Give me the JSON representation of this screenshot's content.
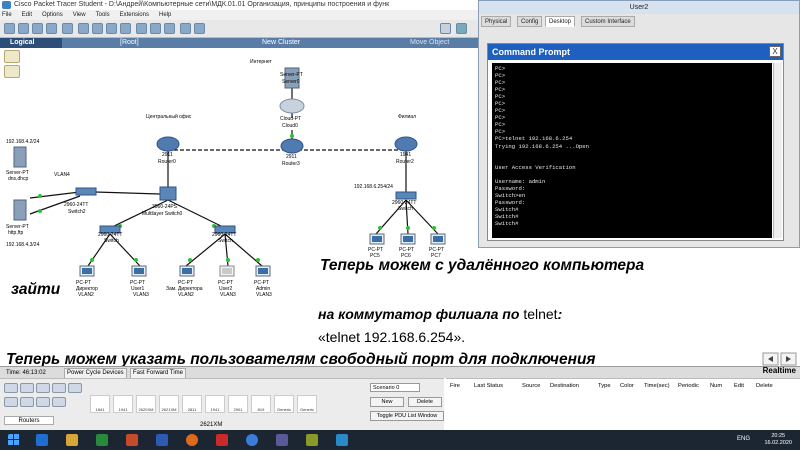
{
  "window": {
    "title": "Cisco Packet Tracer Student - D:\\Андрей\\Компьютерные сети\\МДК.01.01 Организация, принципы построения и функ",
    "menu": [
      "File",
      "Edit",
      "Options",
      "View",
      "Tools",
      "Extensions",
      "Help"
    ]
  },
  "workspace": {
    "mode": "Logical",
    "root": "[Root]",
    "cluster": "New Cluster",
    "move": "Move Object"
  },
  "topology": {
    "labels": {
      "internet": "Интернет",
      "central_office": "Центральный офис",
      "branch": "Филиал",
      "ip_dns": "192.168.4.2/24",
      "ip_http": "192.168.4.3/24",
      "ip_branch_switch": "192.168.6.254/24",
      "vlan4": "VLAN4"
    },
    "devices": {
      "server0": [
        "Server-PT",
        "Server0"
      ],
      "cloud0": [
        "Cloud-PT",
        "Cloud0"
      ],
      "router0": [
        "2911",
        "Router0"
      ],
      "router3": [
        "2911",
        "Router3"
      ],
      "router2": [
        "1941",
        "Router2"
      ],
      "server_dns": [
        "Server-PT",
        "dns,dhcp"
      ],
      "server_http": [
        "Server-PT",
        "http,ftp"
      ],
      "switch2": [
        "2960-24TT",
        "Switch2"
      ],
      "mls0": [
        "3560-24PS",
        "Multilayer Switch0"
      ],
      "switch_a": [
        "2960-24TT",
        "Switch"
      ],
      "switch_b": [
        "2960-24TT",
        "Switch"
      ],
      "switch_branch": [
        "2960-24TT",
        "Switch"
      ],
      "pc_director": [
        "PC-PT",
        "Директор",
        "VLAN2"
      ],
      "pc_user1": [
        "PC-PT",
        "User1",
        "VLAN3"
      ],
      "pc_deputy": [
        "PC-PT",
        "Зам. Директора",
        "VLAN2"
      ],
      "pc_user2": [
        "PC-PT",
        "User2",
        "VLAN3"
      ],
      "pc_admin": [
        "PC-PT",
        "Admin",
        "VLAN3"
      ],
      "pc5": [
        "PC-PT",
        "PC5"
      ],
      "pc6": [
        "PC-PT",
        "PC6"
      ],
      "pc7": [
        "PC-PT",
        "PC7"
      ]
    }
  },
  "user2_window": {
    "title": "User2",
    "tabs": [
      "Physical",
      "Config",
      "Desktop",
      "Custom Interface"
    ],
    "active_tab": "Desktop",
    "cmd_title": "Command Prompt",
    "cmd_close": "X",
    "cmd_lines": [
      "PC>",
      "PC>",
      "PC>",
      "PC>",
      "PC>",
      "PC>",
      "PC>",
      "PC>",
      "PC>",
      "PC>",
      "PC>telnet 192.168.6.254",
      "Trying 192.168.6.254 ...Open",
      "",
      "",
      "User Access Verification",
      "",
      "Username: admin",
      "Password:",
      "Switch>en",
      "Password:",
      "Switch#",
      "Switch#",
      "Switch#"
    ]
  },
  "captions": {
    "line1": "Теперь можем с удалённого компьютера",
    "line2": "зайти",
    "line3_bold": "на коммутатор филиала по ",
    "line3_plain": "telnet",
    "line3_end": ":",
    "line4": "«telnet 192.168.6.254».",
    "line5": "Теперь можем указать пользователям свободный порт для подключения"
  },
  "bottom": {
    "time": "Time: 46:13:02",
    "power_cycle": "Power Cycle Devices",
    "fast_forward": "Fast Forward Time",
    "realtime": "Realtime",
    "category": "Routers",
    "models": [
      "1841",
      "1941",
      "2620XM",
      "2621XM",
      "2811",
      "1941",
      "2901",
      "819",
      "Generic",
      "Generic"
    ],
    "model_name": "2621XM",
    "scenario": "Scenario 0",
    "new_btn": "New",
    "delete_btn": "Delete",
    "toggle_btn": "Toggle PDU List Window",
    "pdu_columns": [
      "Fire",
      "Last Status",
      "Source",
      "Destination",
      "Type",
      "Color",
      "Time(sec)",
      "Periodic",
      "Num",
      "Edit",
      "Delete"
    ]
  },
  "taskbar": {
    "lang": "ENG",
    "time": "20:25",
    "date": "16.02.2020"
  }
}
